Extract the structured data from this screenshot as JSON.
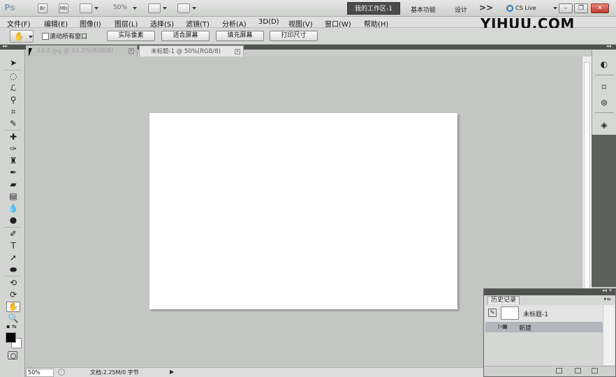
{
  "appbar": {
    "logo": "Ps",
    "bridge_label": "Br",
    "minibridge_label": "Mb",
    "zoom": "50%",
    "workspace_active": "我的工作区-1",
    "workspace_basic": "基本功能",
    "workspace_design": "设计",
    "more": ">>",
    "cs_live": "CS Live"
  },
  "menu": {
    "items": [
      "文件(F)",
      "编辑(E)",
      "图像(I)",
      "图层(L)",
      "选择(S)",
      "滤镜(T)",
      "分析(A)",
      "3D(D)",
      "视图(V)",
      "窗口(W)",
      "帮助(H)"
    ]
  },
  "watermark": "YIHUU.COM",
  "options": {
    "scroll_all_windows": "滚动所有窗口",
    "actual_pixels": "实际像素",
    "fit_screen": "适合屏幕",
    "fill_screen": "填充屏幕",
    "print_size": "打印尺寸"
  },
  "tabs": [
    {
      "label": "11-2.jpg @ 33.3%(RGB/8)"
    },
    {
      "label": "未标题-1 @ 50%(RGB/8)"
    }
  ],
  "status": {
    "zoom": "50%",
    "doc_info": "文档:2.25M/0 字节"
  },
  "history": {
    "tab": "历史记录",
    "snapshot_name": "未标题-1",
    "step_name": "新建"
  }
}
